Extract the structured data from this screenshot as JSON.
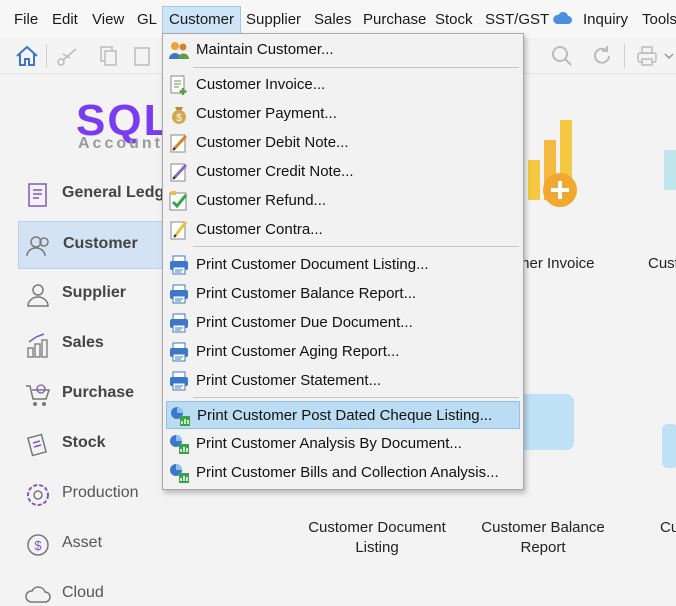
{
  "menubar": {
    "items": [
      "File",
      "Edit",
      "View",
      "GL",
      "Customer",
      "Supplier",
      "Sales",
      "Purchase",
      "Stock",
      "SST/GST",
      "Inquiry",
      "Tools"
    ],
    "active": "Customer"
  },
  "logo": {
    "brand": "SQL",
    "tagline": "Account"
  },
  "sidebar": {
    "items": [
      {
        "label": "General Ledger",
        "icon": "ledger-icon"
      },
      {
        "label": "Customer",
        "icon": "people-icon"
      },
      {
        "label": "Supplier",
        "icon": "person-icon"
      },
      {
        "label": "Sales",
        "icon": "bar-chart-icon"
      },
      {
        "label": "Purchase",
        "icon": "cart-icon"
      },
      {
        "label": "Stock",
        "icon": "clipboard-icon"
      },
      {
        "label": "Production",
        "icon": "gear-icon"
      },
      {
        "label": "Asset",
        "icon": "dollar-icon"
      },
      {
        "label": "Cloud",
        "icon": "cloud-icon"
      }
    ],
    "active": "Customer"
  },
  "tiles": {
    "customer_invoice": "mer Invoice",
    "cust_cut": "Cust",
    "doc_listing": "Customer Document\nListing",
    "balance_report": "Customer Balance\nReport",
    "cut_right": "Cu"
  },
  "dropdown": {
    "items": [
      {
        "label": "Maintain Customer...",
        "icon": "maintain-customer-icon"
      },
      {
        "label": "Customer Invoice...",
        "icon": "invoice-icon"
      },
      {
        "label": "Customer Payment...",
        "icon": "payment-icon"
      },
      {
        "label": "Customer Debit Note...",
        "icon": "debit-note-icon"
      },
      {
        "label": "Customer Credit Note...",
        "icon": "credit-note-icon"
      },
      {
        "label": "Customer Refund...",
        "icon": "refund-icon"
      },
      {
        "label": "Customer Contra...",
        "icon": "contra-icon"
      },
      {
        "label": "Print Customer Document Listing...",
        "icon": "printer-icon"
      },
      {
        "label": "Print Customer Balance Report...",
        "icon": "printer-icon"
      },
      {
        "label": "Print Customer Due Document...",
        "icon": "printer-icon"
      },
      {
        "label": "Print Customer Aging Report...",
        "icon": "printer-icon"
      },
      {
        "label": "Print Customer Statement...",
        "icon": "printer-icon"
      },
      {
        "label": "Print Customer Post Dated Cheque Listing...",
        "icon": "analysis-icon"
      },
      {
        "label": "Print Customer Analysis By Document...",
        "icon": "analysis-icon"
      },
      {
        "label": "Print Customer Bills and Collection Analysis...",
        "icon": "analysis-icon"
      }
    ],
    "highlighted": "Print Customer Post Dated Cheque Listing..."
  },
  "colors": {
    "accent": "#7a3cf0",
    "highlight": "#bcdcf4",
    "print_blue": "#3b78c9"
  }
}
